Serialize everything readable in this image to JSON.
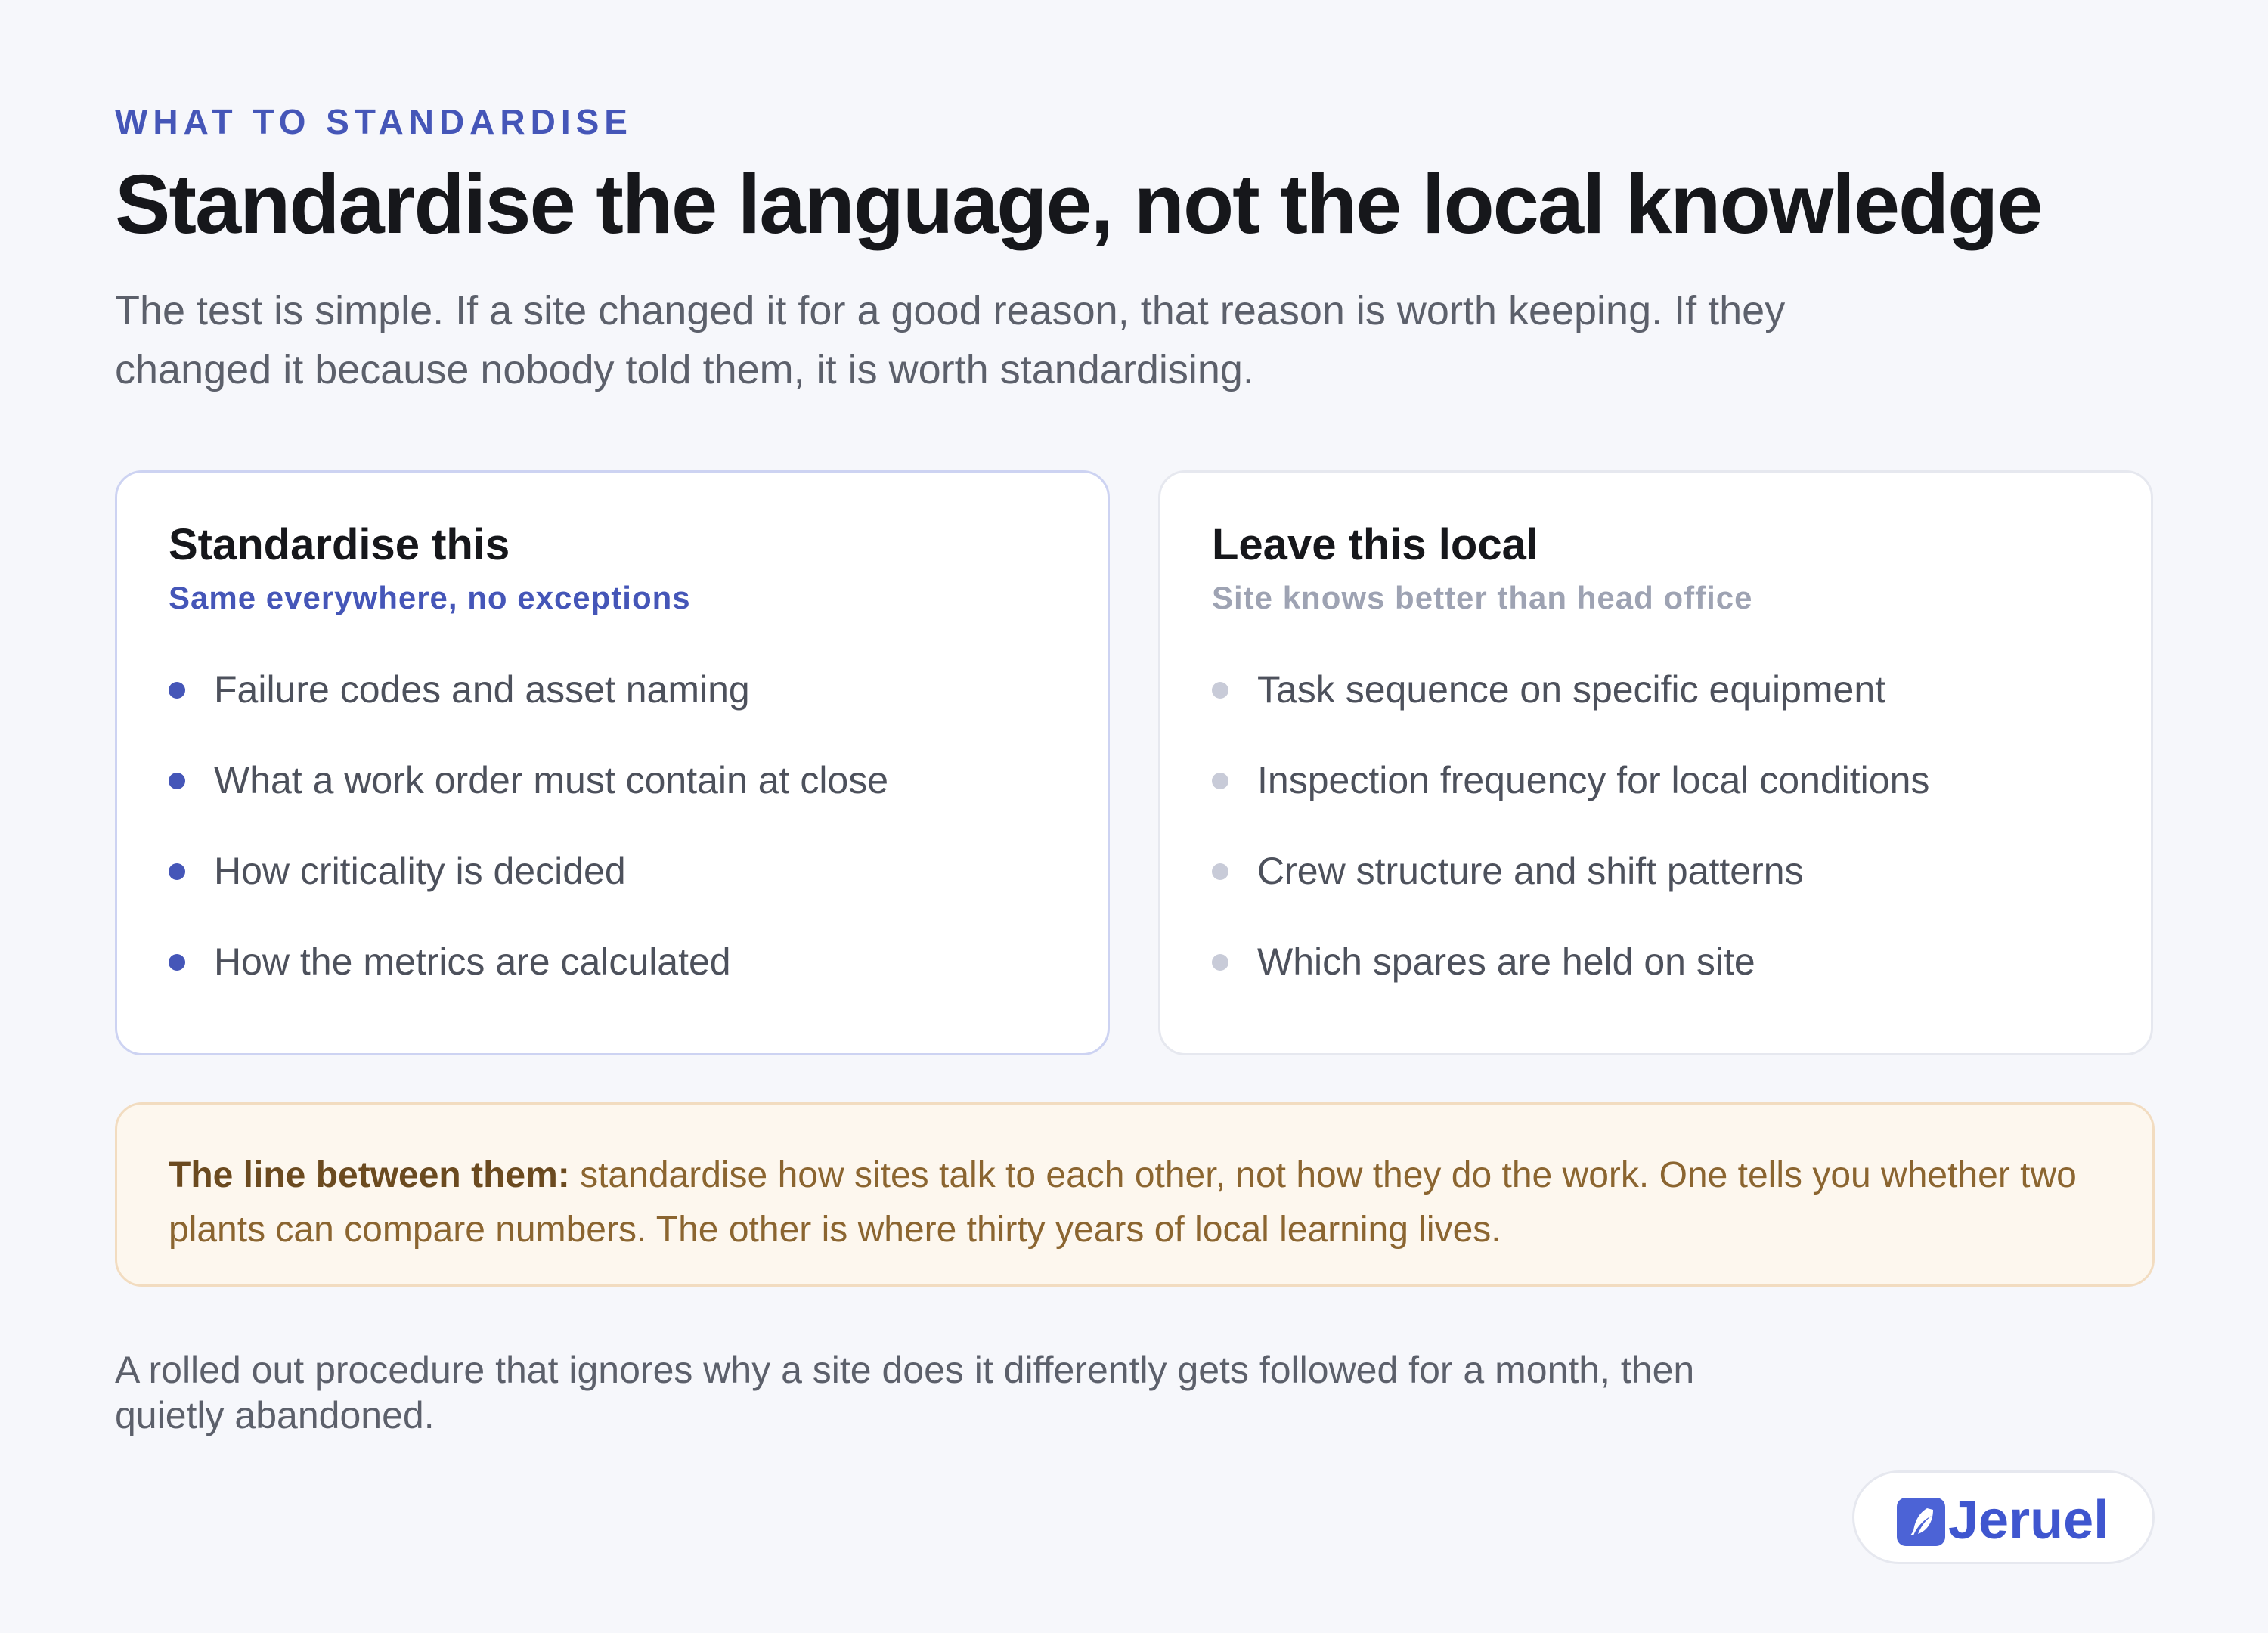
{
  "header": {
    "eyebrow": "WHAT TO STANDARDISE",
    "title": "Standardise the language, not the local knowledge",
    "intro": "The test is simple. If a site changed it for a good reason, that reason is worth keeping. If they changed it because nobody told them, it is worth standardising."
  },
  "cards": {
    "standardise": {
      "title": "Standardise this",
      "subtitle": "Same everywhere, no exceptions",
      "items": [
        "Failure codes and asset naming",
        "What a work order must contain at close",
        "How criticality is decided",
        "How the metrics are calculated"
      ],
      "accent_color": "#4556b8"
    },
    "local": {
      "title": "Leave this local",
      "subtitle": "Site knows better than head office",
      "items": [
        "Task sequence on specific equipment",
        "Inspection frequency for local conditions",
        "Crew structure and shift patterns",
        "Which spares are held on site"
      ],
      "accent_color": "#c8cbd8"
    }
  },
  "callout": {
    "lead": "The line between them:",
    "text": " standardise how sites talk to each other, not how they do the work. One tells you whether two plants can compare numbers. The other is where thirty years of local learning lives."
  },
  "footer": {
    "note": "A rolled out procedure that ignores why a site does it differently gets followed for a month, then quietly abandoned."
  },
  "brand": {
    "name": "Jeruel",
    "icon": "jeruel-logo-icon",
    "color": "#3f56cf"
  }
}
